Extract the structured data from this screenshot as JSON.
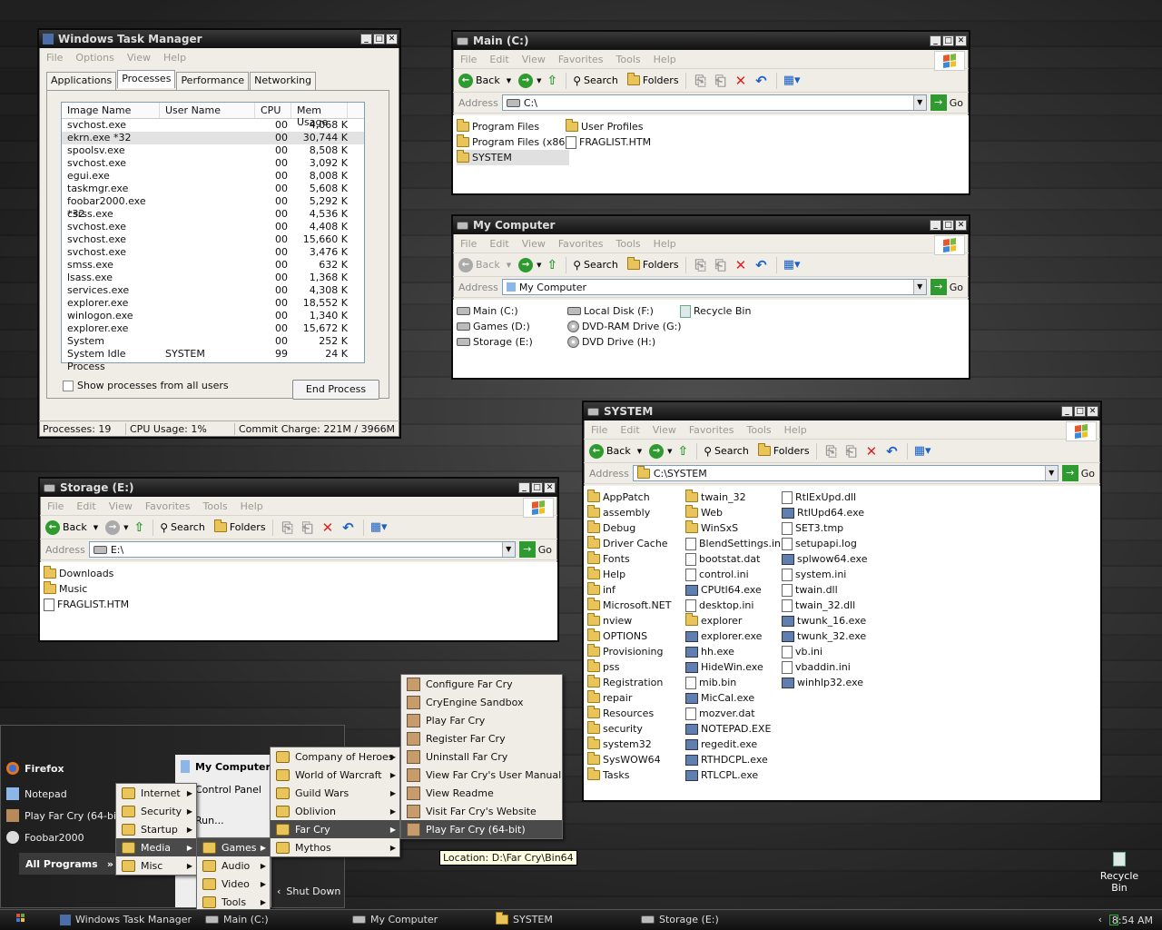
{
  "task_manager": {
    "title": "Windows Task Manager",
    "menu": [
      "File",
      "Options",
      "View",
      "Help"
    ],
    "tabs": [
      "Applications",
      "Processes",
      "Performance",
      "Networking"
    ],
    "columns": [
      "Image Name",
      "User Name",
      "CPU",
      "Mem Usage"
    ],
    "rows": [
      [
        "svchost.exe",
        "",
        "00",
        "4,068 K"
      ],
      [
        "ekrn.exe *32",
        "",
        "00",
        "30,744 K"
      ],
      [
        "spoolsv.exe",
        "",
        "00",
        "8,508 K"
      ],
      [
        "svchost.exe",
        "",
        "00",
        "3,092 K"
      ],
      [
        "egui.exe",
        "",
        "00",
        "8,008 K"
      ],
      [
        "taskmgr.exe",
        "",
        "00",
        "5,608 K"
      ],
      [
        "foobar2000.exe *32",
        "",
        "00",
        "5,292 K"
      ],
      [
        "csrss.exe",
        "",
        "00",
        "4,536 K"
      ],
      [
        "svchost.exe",
        "",
        "00",
        "4,408 K"
      ],
      [
        "svchost.exe",
        "",
        "00",
        "15,660 K"
      ],
      [
        "svchost.exe",
        "",
        "00",
        "3,476 K"
      ],
      [
        "smss.exe",
        "",
        "00",
        "632 K"
      ],
      [
        "lsass.exe",
        "",
        "00",
        "1,368 K"
      ],
      [
        "services.exe",
        "",
        "00",
        "4,308 K"
      ],
      [
        "explorer.exe",
        "",
        "00",
        "18,552 K"
      ],
      [
        "winlogon.exe",
        "",
        "00",
        "1,340 K"
      ],
      [
        "explorer.exe",
        "",
        "00",
        "15,672 K"
      ],
      [
        "System",
        "",
        "00",
        "252 K"
      ],
      [
        "System Idle Process",
        "SYSTEM",
        "99",
        "24 K"
      ]
    ],
    "show_all": "Show processes from all users",
    "end_process": "End Process",
    "status": {
      "processes": "Processes: 19",
      "cpu": "CPU Usage: 1%",
      "commit": "Commit Charge: 221M / 3966M"
    }
  },
  "explorer_common": {
    "menu": [
      "File",
      "Edit",
      "View",
      "Favorites",
      "Tools",
      "Help"
    ],
    "back": "Back",
    "search": "Search",
    "folders": "Folders",
    "address_label": "Address",
    "go": "Go"
  },
  "main_c": {
    "title": "Main (C:)",
    "address": "C:\\",
    "col1": [
      "Program Files",
      "Program Files (x86)",
      "SYSTEM"
    ],
    "col2": [
      "User Profiles",
      "FRAGLIST.HTM"
    ]
  },
  "my_computer": {
    "title": "My Computer",
    "address": "My Computer",
    "col1": [
      "Main (C:)",
      "Games (D:)",
      "Storage (E:)"
    ],
    "col2": [
      "Local Disk (F:)",
      "DVD-RAM Drive (G:)",
      "DVD Drive (H:)"
    ],
    "col3": [
      "Recycle Bin"
    ]
  },
  "storage_e": {
    "title": "Storage (E:)",
    "address": "E:\\",
    "col1": [
      "Downloads",
      "Music",
      "FRAGLIST.HTM"
    ]
  },
  "system": {
    "title": "SYSTEM",
    "address": "C:\\SYSTEM",
    "col1": [
      "AppPatch",
      "assembly",
      "Debug",
      "Driver Cache",
      "Fonts",
      "Help",
      "inf",
      "Microsoft.NET",
      "nview",
      "OPTIONS",
      "Provisioning",
      "pss",
      "Registration",
      "repair",
      "Resources",
      "security",
      "system32",
      "SysWOW64",
      "Tasks"
    ],
    "col2": [
      "twain_32",
      "Web",
      "WinSxS",
      "BlendSettings.ini",
      "bootstat.dat",
      "control.ini",
      "CPUtl64.exe",
      "desktop.ini",
      "explorer",
      "explorer.exe",
      "hh.exe",
      "HideWin.exe",
      "mib.bin",
      "MicCal.exe",
      "mozver.dat",
      "NOTEPAD.EXE",
      "regedit.exe",
      "RTHDCPL.exe",
      "RTLCPL.exe"
    ],
    "col3": [
      "RtlExUpd.dll",
      "RtlUpd64.exe",
      "SET3.tmp",
      "setupapi.log",
      "splwow64.exe",
      "system.ini",
      "twain.dll",
      "twain_32.dll",
      "twunk_16.exe",
      "twunk_32.exe",
      "vb.ini",
      "vbaddin.ini",
      "winhlp32.exe"
    ]
  },
  "start_menu": {
    "pinned": [
      "Firefox",
      "Notepad",
      "Play Far Cry (64-bit)",
      "Foobar2000"
    ],
    "all_programs": "All Programs",
    "right": [
      "My Computer",
      "Control Panel",
      "Run...",
      "Shut Down"
    ],
    "programs": [
      "Internet",
      "Security",
      "Startup",
      "Media",
      "Misc"
    ],
    "media": [
      "Games",
      "Audio",
      "Video",
      "Tools"
    ],
    "games": [
      "Company of Heroes",
      "World of Warcraft",
      "Guild Wars",
      "Oblivion",
      "Far Cry",
      "Mythos"
    ],
    "farcry": [
      "Configure Far Cry",
      "CryEngine Sandbox",
      "Play Far Cry",
      "Register Far Cry",
      "Uninstall Far Cry",
      "View Far Cry's User Manual",
      "View Readme",
      "Visit Far Cry's Website",
      "Play Far Cry (64-bit)"
    ],
    "tooltip": "Location: D:\\Far Cry\\Bin64"
  },
  "taskbar": {
    "buttons": [
      "Windows Task Manager",
      "Main (C:)",
      "My Computer",
      "SYSTEM",
      "Storage (E:)"
    ],
    "clock": "8:54 AM"
  },
  "desktop": {
    "recycle_bin": "Recycle Bin"
  }
}
